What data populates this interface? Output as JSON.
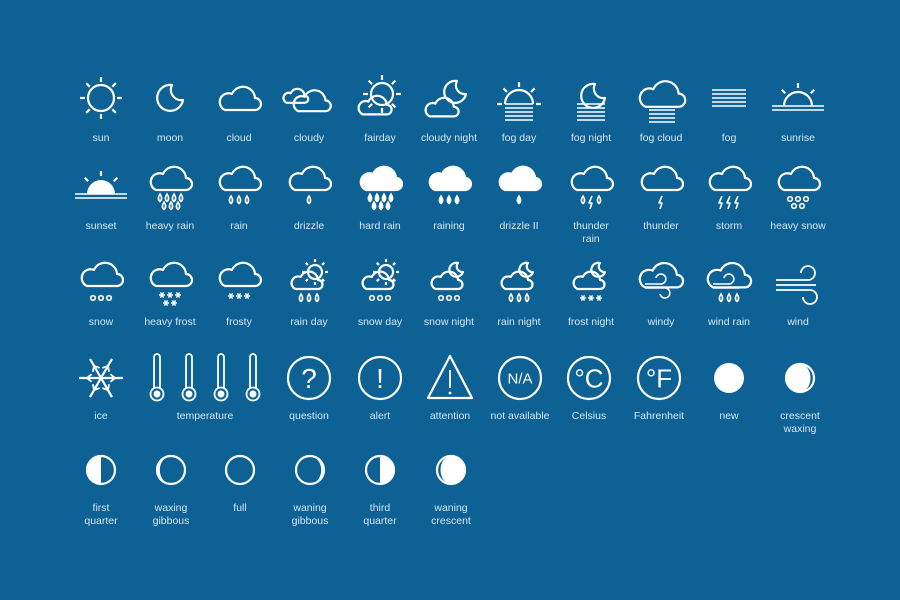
{
  "colors": {
    "background": "#0d6195",
    "icon": "#ffffff",
    "label": "#d6e6f2"
  },
  "rows": [
    [
      {
        "label": "sun",
        "icon": "sun-icon"
      },
      {
        "label": "moon",
        "icon": "moon-icon"
      },
      {
        "label": "cloud",
        "icon": "cloud-icon"
      },
      {
        "label": "cloudy",
        "icon": "cloudy-icon"
      },
      {
        "label": "fairday",
        "icon": "fairday-icon"
      },
      {
        "label": "cloudy night",
        "icon": "cloudy-night-icon"
      },
      {
        "label": "fog day",
        "icon": "fog-day-icon"
      },
      {
        "label": "fog night",
        "icon": "fog-night-icon"
      },
      {
        "label": "fog cloud",
        "icon": "fog-cloud-icon"
      },
      {
        "label": "fog",
        "icon": "fog-icon"
      },
      {
        "label": "sunrise",
        "icon": "sunrise-icon"
      }
    ],
    [
      {
        "label": "sunset",
        "icon": "sunset-icon"
      },
      {
        "label": "heavy rain",
        "icon": "heavy-rain-icon"
      },
      {
        "label": "rain",
        "icon": "rain-icon"
      },
      {
        "label": "drizzle",
        "icon": "drizzle-icon"
      },
      {
        "label": "hard rain",
        "icon": "hard-rain-icon"
      },
      {
        "label": "raining",
        "icon": "raining-icon"
      },
      {
        "label": "drizzle II",
        "icon": "drizzle-ii-icon"
      },
      {
        "label": "thunder\nrain",
        "icon": "thunder-rain-icon"
      },
      {
        "label": "thunder",
        "icon": "thunder-icon"
      },
      {
        "label": "storm",
        "icon": "storm-icon"
      },
      {
        "label": "heavy snow",
        "icon": "heavy-snow-icon"
      }
    ],
    [
      {
        "label": "snow",
        "icon": "snow-icon"
      },
      {
        "label": "heavy  frost",
        "icon": "heavy-frost-icon"
      },
      {
        "label": "frosty",
        "icon": "frosty-icon"
      },
      {
        "label": "rain day",
        "icon": "rain-day-icon"
      },
      {
        "label": "snow day",
        "icon": "snow-day-icon"
      },
      {
        "label": "snow night",
        "icon": "snow-night-icon"
      },
      {
        "label": "rain night",
        "icon": "rain-night-icon"
      },
      {
        "label": "frost night",
        "icon": "frost-night-icon"
      },
      {
        "label": "windy",
        "icon": "windy-icon"
      },
      {
        "label": "wind rain",
        "icon": "wind-rain-icon"
      },
      {
        "label": "wind",
        "icon": "wind-icon"
      }
    ],
    [
      {
        "label": "ice",
        "icon": "snowflake-icon"
      },
      {
        "label": "temperature",
        "icon": "thermometers-icon"
      },
      {
        "label": "question",
        "icon": "question-icon",
        "glyph": "?"
      },
      {
        "label": "alert",
        "icon": "alert-icon",
        "glyph": "!"
      },
      {
        "label": "attention",
        "icon": "attention-icon"
      },
      {
        "label": "not available",
        "icon": "not-available-icon",
        "glyph": "N/A"
      },
      {
        "label": "Celsius",
        "icon": "celsius-icon",
        "glyph": "°C"
      },
      {
        "label": "Fahrenheit",
        "icon": "fahrenheit-icon",
        "glyph": "°F"
      },
      {
        "label": "new",
        "icon": "moon-new-icon"
      },
      {
        "label": "crescent\nwaxing",
        "icon": "moon-crescent-waxing-icon"
      }
    ],
    [
      {
        "label": "first\nquarter",
        "icon": "moon-first-quarter-icon"
      },
      {
        "label": "waxing\ngibbous",
        "icon": "moon-waxing-gibbous-icon"
      },
      {
        "label": "full",
        "icon": "moon-full-icon"
      },
      {
        "label": "waning\ngibbous",
        "icon": "moon-waning-gibbous-icon"
      },
      {
        "label": "third\nquarter",
        "icon": "moon-third-quarter-icon"
      },
      {
        "label": "waning\ncrescent",
        "icon": "moon-waning-crescent-icon"
      }
    ]
  ]
}
